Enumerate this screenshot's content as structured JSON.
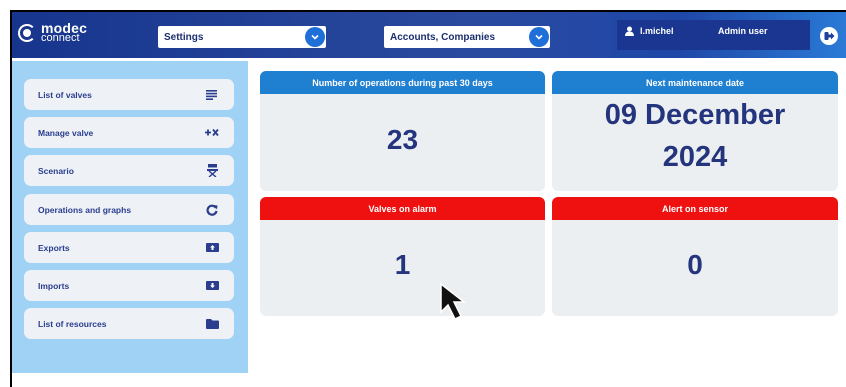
{
  "header": {
    "logo": {
      "line1": "modec",
      "line2": "connect"
    },
    "settings_select": "Settings",
    "accounts_select": "Accounts, Companies",
    "user_name": "l.michel",
    "user_role": "Admin user"
  },
  "sidebar": {
    "items": [
      {
        "label": "List of valves",
        "icon": "list-icon"
      },
      {
        "label": "Manage valve",
        "icon": "plus-x-icon"
      },
      {
        "label": "Scenario",
        "icon": "director-chair-icon"
      },
      {
        "label": "Operations and graphs",
        "icon": "refresh-icon"
      },
      {
        "label": "Exports",
        "icon": "export-icon"
      },
      {
        "label": "Imports",
        "icon": "import-icon"
      },
      {
        "label": "List of resources",
        "icon": "folder-icon"
      }
    ]
  },
  "cards": {
    "operations": {
      "title": "Number of operations during past 30 days",
      "value": "23"
    },
    "maintenance": {
      "title": "Next maintenance date",
      "value_line1": "09 December",
      "value_line2": "2024"
    },
    "alarm": {
      "title": "Valves on alarm",
      "value": "1"
    },
    "sensor": {
      "title": "Alert on sensor",
      "value": "0"
    }
  },
  "colors": {
    "topbar": "#17358c",
    "accent_blue": "#1f7fd0",
    "alert_red": "#ef1010",
    "sidebar_bg": "#9fd2f5",
    "value_text": "#24357e"
  }
}
